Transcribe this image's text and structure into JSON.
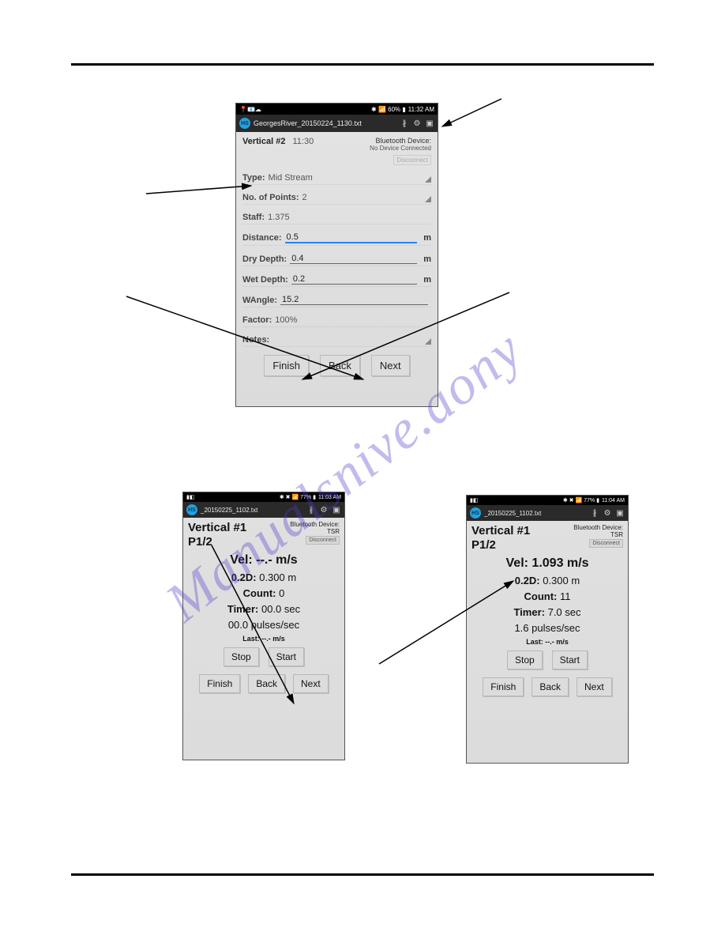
{
  "phone1": {
    "status": {
      "left_icons": "📍📧☁",
      "right": "✱ 📶 60% ▮",
      "clock": "11:32 AM"
    },
    "titlebar": {
      "file": "GeorgesRiver_20150224_1130.txt"
    },
    "header": {
      "title": "Vertical #2",
      "time": "11:30",
      "bt_label": "Bluetooth Device:",
      "bt_value": "No Device Connected",
      "disconnect": "Disconnect"
    },
    "fields": {
      "type_label": "Type:",
      "type_value": "Mid Stream",
      "nop_label": "No. of Points:",
      "nop_value": "2",
      "staff_label": "Staff:",
      "staff_value": "1.375",
      "distance_label": "Distance:",
      "distance_value": "0.5",
      "distance_unit": "m",
      "dry_label": "Dry Depth:",
      "dry_value": "0.4",
      "dry_unit": "m",
      "wet_label": "Wet Depth:",
      "wet_value": "0.2",
      "wet_unit": "m",
      "wang_label": "WAngle:",
      "wang_value": "15.2",
      "factor_label": "Factor:",
      "factor_value": "100%",
      "notes_label": "Notes:"
    },
    "buttons": {
      "finish": "Finish",
      "back": "Back",
      "next": "Next"
    }
  },
  "phone2": {
    "status": {
      "left_icons": "▮◧",
      "right": "✱ ✖ 📶 77% ▮",
      "clock": "11:03 AM"
    },
    "titlebar": {
      "file": "_20150225_1102.txt"
    },
    "header": {
      "vertical": "Vertical #1",
      "point": "P1/2",
      "bt_label": "Bluetooth Device:",
      "bt_name": "TSR",
      "disconnect": "Disconnect"
    },
    "readings": {
      "vel_label": "Vel:",
      "vel_value": "--.-",
      "vel_unit": "m/s",
      "dep_label": "0.2D:",
      "dep_value": "0.300 m",
      "count_label": "Count:",
      "count_value": "0",
      "timer_label": "Timer:",
      "timer_value": "00.0 sec",
      "pulses": "00.0 pulses/sec",
      "last_label": "Last:",
      "last_value": "--.- m/s"
    },
    "buttons": {
      "stop": "Stop",
      "start": "Start",
      "finish": "Finish",
      "back": "Back",
      "next": "Next"
    }
  },
  "phone3": {
    "status": {
      "left_icons": "▮◧",
      "right": "✱ ✖ 📶 77% ▮",
      "clock": "11:04 AM"
    },
    "titlebar": {
      "file": "_20150225_1102.txt"
    },
    "header": {
      "vertical": "Vertical #1",
      "point": "P1/2",
      "bt_label": "Bluetooth Device:",
      "bt_name": "TSR",
      "disconnect": "Disconnect"
    },
    "readings": {
      "vel_label": "Vel:",
      "vel_value": "1.093",
      "vel_unit": "m/s",
      "dep_label": "0.2D:",
      "dep_value": "0.300 m",
      "count_label": "Count:",
      "count_value": "11",
      "timer_label": "Timer:",
      "timer_value": "7.0 sec",
      "pulses": "1.6 pulses/sec",
      "last_label": "Last:",
      "last_value": "--.- m/s"
    },
    "buttons": {
      "stop": "Stop",
      "start": "Start",
      "finish": "Finish",
      "back": "Back",
      "next": "Next"
    }
  },
  "watermark": "Manualsnive.aony"
}
